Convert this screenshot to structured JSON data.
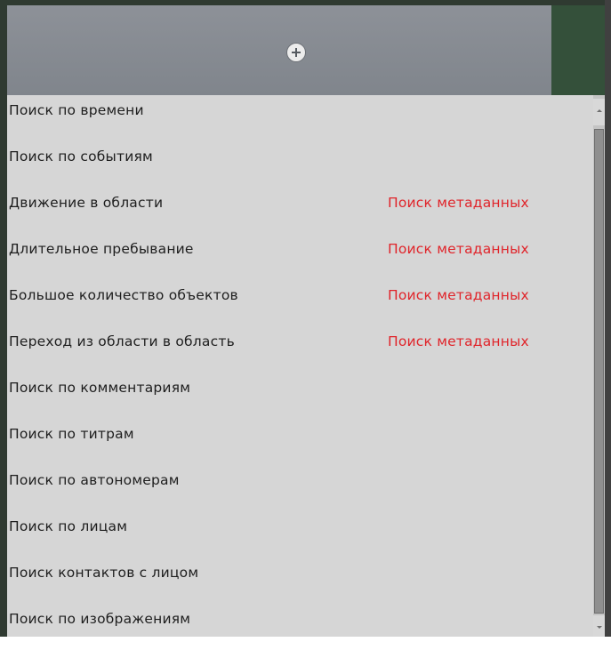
{
  "header": {
    "add_icon": "plus-circle-icon"
  },
  "menu": {
    "items": [
      {
        "label": "Поиск по времени",
        "tag": ""
      },
      {
        "label": "Поиск по событиям",
        "tag": ""
      },
      {
        "label": "Движение в области",
        "tag": "Поиск метаданных"
      },
      {
        "label": "Длительное пребывание",
        "tag": "Поиск метаданных"
      },
      {
        "label": "Большое количество объектов",
        "tag": "Поиск метаданных"
      },
      {
        "label": "Переход из области в область",
        "tag": "Поиск метаданных"
      },
      {
        "label": "Поиск по комментариям",
        "tag": ""
      },
      {
        "label": "Поиск по титрам",
        "tag": ""
      },
      {
        "label": "Поиск по автономерам",
        "tag": ""
      },
      {
        "label": "Поиск по лицам",
        "tag": ""
      },
      {
        "label": "Поиск контактов с лицом",
        "tag": ""
      },
      {
        "label": "Поиск по изображениям",
        "tag": ""
      }
    ]
  },
  "colors": {
    "tag_color": "#e0242a",
    "list_background": "#d6d6d6",
    "header_tab": "#868a91"
  }
}
